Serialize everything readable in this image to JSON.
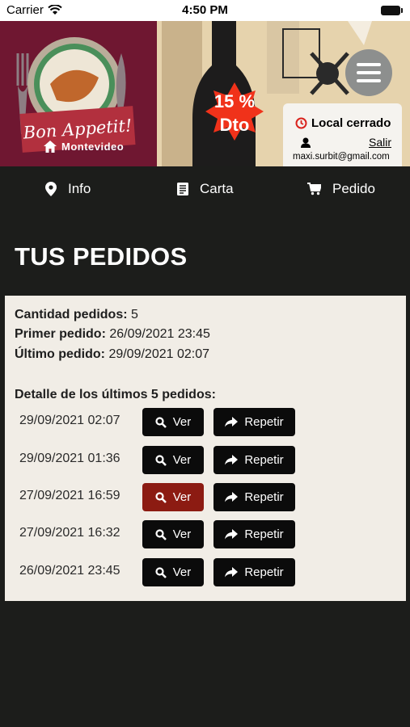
{
  "status_bar": {
    "carrier": "Carrier",
    "time": "4:50 PM"
  },
  "banner": {
    "brand_title": "Bon Appetit!",
    "brand_city": "Montevideo",
    "discount_line1": "15 %",
    "discount_line2": "Dto",
    "local_status": "Local cerrado",
    "logout_label": "Salir",
    "user_email": "maxi.surbit@gmail.com"
  },
  "nav": {
    "items": [
      {
        "label": "Info",
        "icon": "map-pin-icon"
      },
      {
        "label": "Carta",
        "icon": "menu-list-icon"
      },
      {
        "label": "Pedido",
        "icon": "cart-icon"
      }
    ]
  },
  "page": {
    "title": "TUS PEDIDOS",
    "count_label": "Cantidad pedidos:",
    "count_value": "5",
    "first_label": "Primer pedido:",
    "first_value": "26/09/2021 23:45",
    "last_label": "Último pedido:",
    "last_value": "29/09/2021 02:07",
    "detail_title": "Detalle de los últimos 5 pedidos:"
  },
  "orders": [
    {
      "date": "29/09/2021 02:07",
      "view_label": "Ver",
      "repeat_label": "Repetir"
    },
    {
      "date": "29/09/2021 01:36",
      "view_label": "Ver",
      "repeat_label": "Repetir"
    },
    {
      "date": "27/09/2021 16:59",
      "view_label": "Ver",
      "repeat_label": "Repetir"
    },
    {
      "date": "27/09/2021 16:32",
      "view_label": "Ver",
      "repeat_label": "Repetir"
    },
    {
      "date": "26/09/2021 23:45",
      "view_label": "Ver",
      "repeat_label": "Repetir"
    }
  ],
  "colors": {
    "accent_red": "#8c1b12",
    "discount_red": "#f0321a",
    "clock_red": "#d9221c"
  }
}
